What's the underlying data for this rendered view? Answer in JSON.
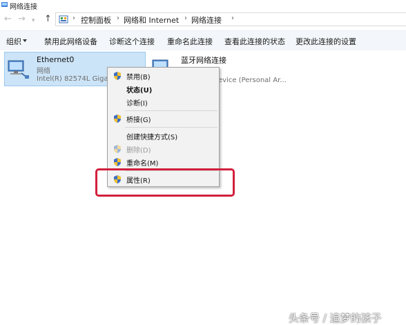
{
  "window": {
    "title": "网络连接"
  },
  "address": {
    "crumbs": [
      "控制面板",
      "网络和 Internet",
      "网络连接"
    ]
  },
  "toolbar": {
    "organize_label": "组织",
    "items": [
      "禁用此网络设备",
      "诊断这个连接",
      "重命名此连接",
      "查看此连接的状态",
      "更改此连接的设置"
    ]
  },
  "connections": [
    {
      "name": "Ethernet0",
      "status": "网络",
      "device": "Intel(R) 82574L Gigabit",
      "selected": true
    },
    {
      "name": "蓝牙网络连接",
      "status": "",
      "device": "evice (Personal Ar...",
      "selected": false
    }
  ],
  "context_menu": {
    "items": [
      {
        "label": "禁用(B)",
        "shield": true,
        "bold": false,
        "disabled": false
      },
      {
        "label": "状态(U)",
        "shield": false,
        "bold": true,
        "disabled": false
      },
      {
        "label": "诊断(I)",
        "shield": false,
        "bold": false,
        "disabled": false
      },
      {
        "label": "桥接(G)",
        "shield": true,
        "bold": false,
        "disabled": false
      },
      {
        "label": "创建快捷方式(S)",
        "shield": false,
        "bold": false,
        "disabled": false
      },
      {
        "label": "删除(D)",
        "shield": true,
        "bold": false,
        "disabled": true
      },
      {
        "label": "重命名(M)",
        "shield": true,
        "bold": false,
        "disabled": false
      },
      {
        "label": "属性(R)",
        "shield": true,
        "bold": false,
        "disabled": false
      }
    ]
  },
  "colors": {
    "selection_bg": "#cce4f7",
    "highlight_border": "#d21f3c",
    "toolbar_bg": "#f3f6fa"
  },
  "watermark": "头条号 / 追梦的孩子"
}
